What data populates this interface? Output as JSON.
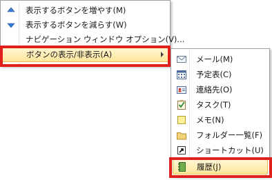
{
  "main_menu": {
    "items": [
      {
        "label": "表示するボタンを増やす(M)",
        "icon": "arrow-up-icon"
      },
      {
        "label": "表示するボタンを減らす(W)",
        "icon": "arrow-down-icon"
      },
      {
        "label": "ナビゲーション ウィンドウ オプション(V)...",
        "icon": ""
      },
      {
        "label": "ボタンの表示/非表示(A)",
        "icon": "submenu-arrow-icon",
        "highlighted": true
      }
    ]
  },
  "sub_menu": {
    "items": [
      {
        "label": "メール(M)",
        "icon": "mail-icon"
      },
      {
        "label": "予定表(C)",
        "icon": "calendar-icon"
      },
      {
        "label": "連絡先(O)",
        "icon": "contacts-icon"
      },
      {
        "label": "タスク(T)",
        "icon": "tasks-icon"
      },
      {
        "label": "メモ(N)",
        "icon": "notes-icon"
      },
      {
        "label": "フォルダー一覧(F)",
        "icon": "folder-list-icon"
      },
      {
        "label": "ショートカット(U)",
        "icon": "shortcut-icon"
      },
      {
        "label": "履歴(J)",
        "icon": "journal-icon",
        "highlighted": true
      }
    ]
  },
  "colors": {
    "highlight_outline": "#e0201b",
    "hover_gradient_top": "#fff6d4",
    "hover_gradient_bottom": "#ffe69a"
  }
}
